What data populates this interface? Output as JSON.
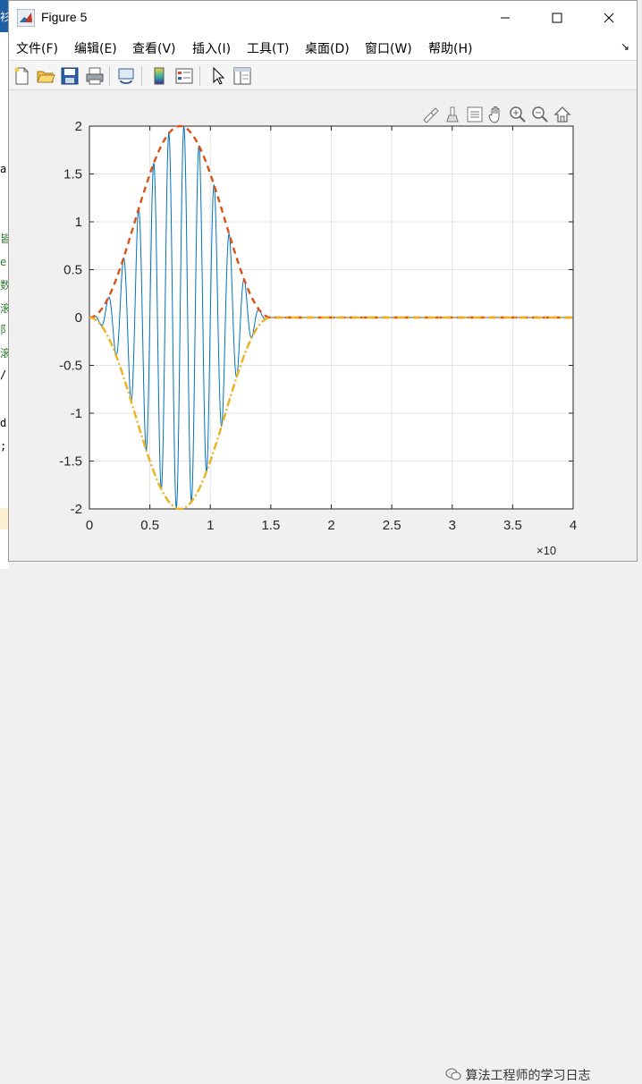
{
  "window": {
    "title": "Figure 5"
  },
  "menu": {
    "items": [
      {
        "label": "文件(F)"
      },
      {
        "label": "编辑(E)"
      },
      {
        "label": "查看(V)"
      },
      {
        "label": "插入(I)"
      },
      {
        "label": "工具(T)"
      },
      {
        "label": "桌面(D)"
      },
      {
        "label": "窗口(W)"
      },
      {
        "label": "帮助(H)"
      }
    ]
  },
  "toolbar": {
    "buttons": [
      "new-figure",
      "open-file",
      "save-figure",
      "print-figure",
      "link-plot",
      "insert-colorbar",
      "insert-legend",
      "edit-plot",
      "property-inspector"
    ]
  },
  "axes_toolbar": [
    "brush",
    "data-tips",
    "data-cursor",
    "pan",
    "zoom-in",
    "zoom-out",
    "restore-view"
  ],
  "background_fragments": [
    "衫",
    "ar",
    "皆",
    "e",
    "数",
    "滚",
    "阝",
    "滚",
    "/",
    "d",
    ";"
  ],
  "watermark": "算法工程师的学习日志",
  "chart_data": {
    "type": "line",
    "title": "",
    "xlabel": "",
    "ylabel": "",
    "xlim": [
      0,
      4
    ],
    "ylim": [
      -2,
      2
    ],
    "x_exponent_label": "×10",
    "xticks": [
      0,
      0.5,
      1,
      1.5,
      2,
      2.5,
      3,
      3.5,
      4
    ],
    "yticks": [
      -2,
      -1.5,
      -1,
      -0.5,
      0,
      0.5,
      1,
      1.5,
      2
    ],
    "grid": true,
    "series": [
      {
        "style": "solid",
        "color": "#0072bd",
        "description": "oscillating signal 2*sin(pi*x/1.5)^2 * sin(2*pi*8*x) for 0<=x<=1.5, zero beyond",
        "sample_points": {
          "x": [
            0,
            0.25,
            0.5,
            0.75,
            1.0,
            1.25,
            1.5,
            2,
            3,
            4
          ],
          "envelope": [
            0,
            0.5,
            1.5,
            2.0,
            1.5,
            0.5,
            0,
            0,
            0,
            0
          ]
        }
      },
      {
        "style": "dashed",
        "color": "#d95319",
        "description": "upper envelope",
        "x": [
          0,
          0.25,
          0.5,
          0.75,
          1.0,
          1.25,
          1.5,
          2,
          3,
          4
        ],
        "y": [
          0,
          0.5,
          1.5,
          2.0,
          1.5,
          0.5,
          0,
          0,
          0,
          0
        ]
      },
      {
        "style": "dash-dot",
        "color": "#edb120",
        "description": "lower envelope",
        "x": [
          0,
          0.25,
          0.5,
          0.75,
          1.0,
          1.25,
          1.5,
          2,
          3,
          4
        ],
        "y": [
          0,
          -0.5,
          -1.5,
          -2.0,
          -1.5,
          -0.5,
          0,
          0,
          0,
          0
        ]
      }
    ]
  }
}
